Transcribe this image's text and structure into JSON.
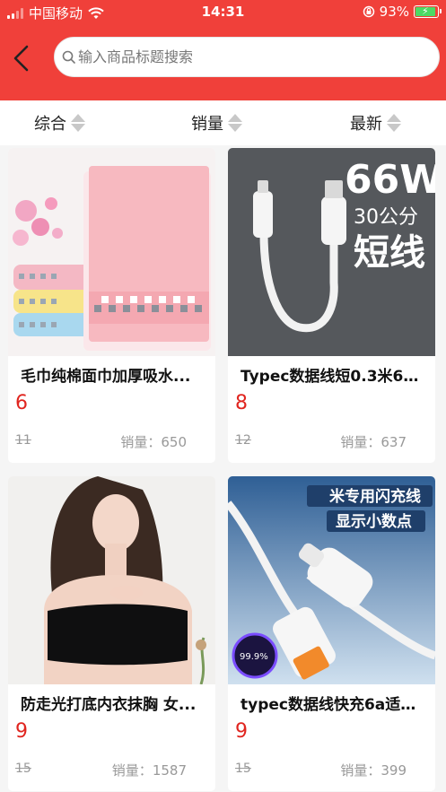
{
  "status_bar": {
    "carrier": "中国移动",
    "time": "14:31",
    "battery": "93%"
  },
  "search": {
    "placeholder": "输入商品标题搜索"
  },
  "sort_tabs": [
    "综合",
    "销量",
    "最新"
  ],
  "sales_label": "销量：",
  "products": [
    {
      "title": "毛巾纯棉面巾加厚吸水...",
      "price": "6",
      "old_price": "11",
      "sales": "650"
    },
    {
      "title": "Typec数据线短0.3米66...",
      "price": "8",
      "old_price": "12",
      "sales": "637",
      "image_text": {
        "big": "66W",
        "mid": "30公分",
        "short": "短线"
      }
    },
    {
      "title": "防走光打底内衣抹胸 女...",
      "price": "9",
      "old_price": "15",
      "sales": "1587"
    },
    {
      "title": "typec数据线快充6a适用...",
      "price": "9",
      "old_price": "15",
      "sales": "399",
      "image_text": {
        "line1": "米专用闪充线",
        "line2": "显示小数点",
        "badge": "99.9%"
      }
    }
  ],
  "colors": {
    "header": "#f0403a",
    "price": "#e0251f"
  }
}
